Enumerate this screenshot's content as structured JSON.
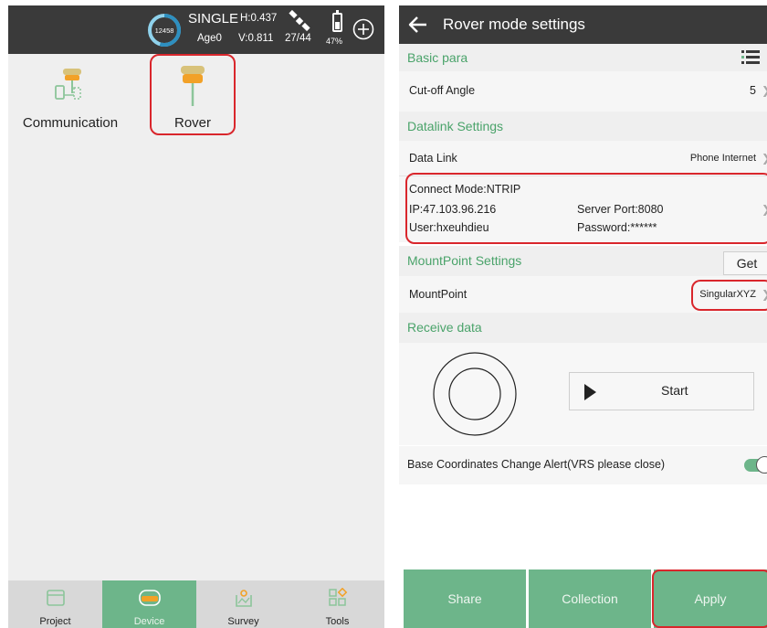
{
  "left_screen": {
    "status_bar": {
      "satellite_gauge_value": "12458",
      "solution": "SINGLE",
      "age": "Age0",
      "h_precision": "H:0.437",
      "v_precision": "V:0.811",
      "satellites": "27/44",
      "battery": "47%",
      "battery_level_fraction": 0.47,
      "icons": [
        "satellite-icon",
        "battery-icon",
        "add-circle-icon"
      ]
    },
    "apps": [
      {
        "label": "Communication",
        "icon": "communication-icon"
      },
      {
        "label": "Rover",
        "icon": "rover-receiver-icon"
      }
    ],
    "bottom_nav": [
      {
        "label": "Project",
        "icon": "project-icon",
        "active": false
      },
      {
        "label": "Device",
        "icon": "device-icon",
        "active": true
      },
      {
        "label": "Survey",
        "icon": "survey-icon",
        "active": false
      },
      {
        "label": "Tools",
        "icon": "tools-icon",
        "active": false
      }
    ]
  },
  "right_screen": {
    "title": "Rover mode settings",
    "basic_para": {
      "heading": "Basic para",
      "cutoff_label": "Cut-off Angle",
      "cutoff_value": "5"
    },
    "datalink": {
      "heading": "Datalink Settings",
      "data_link_label": "Data Link",
      "data_link_value": "Phone Internet",
      "connect_mode": "Connect Mode:NTRIP",
      "ip": "IP:47.103.96.216",
      "server_port": "Server Port:8080",
      "user": "User:hxeuhdieu",
      "password": "Password:******"
    },
    "mountpoint": {
      "heading": "MountPoint Settings",
      "get_label": "Get",
      "label": "MountPoint",
      "value": "SingularXYZ"
    },
    "receive": {
      "heading": "Receive data",
      "start_label": "Start"
    },
    "alert": {
      "label": "Base Coordinates Change Alert(VRS please close)",
      "enabled": true
    },
    "buttons": {
      "share": "Share",
      "collection": "Collection",
      "apply": "Apply"
    },
    "colors": {
      "accent_green": "#6db58a",
      "section_text": "#4aa36a",
      "highlight_red": "#d9262c",
      "header_dark": "#3a3a3a"
    }
  }
}
